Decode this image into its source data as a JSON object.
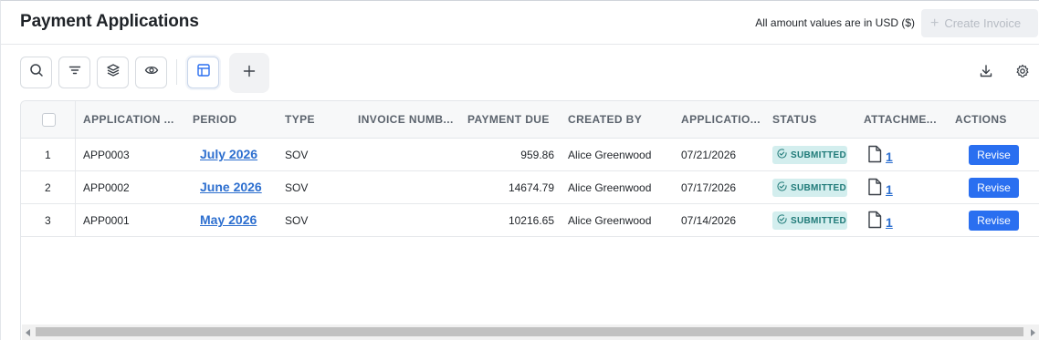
{
  "header": {
    "title": "Payment Applications",
    "usd_note": "All amount values are in USD ($)",
    "create_invoice_label": "Create Invoice"
  },
  "toolbar": {
    "icons": [
      "search-icon",
      "filter-icon",
      "layers-icon",
      "eye-icon",
      "table-view-icon",
      "add-icon"
    ],
    "right_icons": [
      "download-icon",
      "gear-icon"
    ]
  },
  "table": {
    "columns": [
      "APPLICATION ...",
      "PERIOD",
      "TYPE",
      "INVOICE NUMB...",
      "PAYMENT DUE",
      "CREATED BY",
      "APPLICATIO...",
      "STATUS",
      "ATTACHME...",
      "ACTIONS"
    ],
    "rows": [
      {
        "index": "1",
        "application": "APP0003",
        "period": "July 2026",
        "type": "SOV",
        "invoice_number": "",
        "payment_due": "959.86",
        "created_by": "Alice Greenwood",
        "application_date": "07/21/2026",
        "status": "SUBMITTED",
        "attachments": "1",
        "action": "Revise"
      },
      {
        "index": "2",
        "application": "APP0002",
        "period": "June 2026",
        "type": "SOV",
        "invoice_number": "",
        "payment_due": "14674.79",
        "created_by": "Alice Greenwood",
        "application_date": "07/17/2026",
        "status": "SUBMITTED",
        "attachments": "1",
        "action": "Revise"
      },
      {
        "index": "3",
        "application": "APP0001",
        "period": "May 2026",
        "type": "SOV",
        "invoice_number": "",
        "payment_due": "10216.65",
        "created_by": "Alice Greenwood",
        "application_date": "07/14/2026",
        "status": "SUBMITTED",
        "attachments": "1",
        "action": "Revise"
      }
    ]
  },
  "colors": {
    "accent": "#2a6ff0",
    "link": "#2d6fcf",
    "status_bg": "#d3eeee",
    "status_text": "#1f7a78"
  }
}
